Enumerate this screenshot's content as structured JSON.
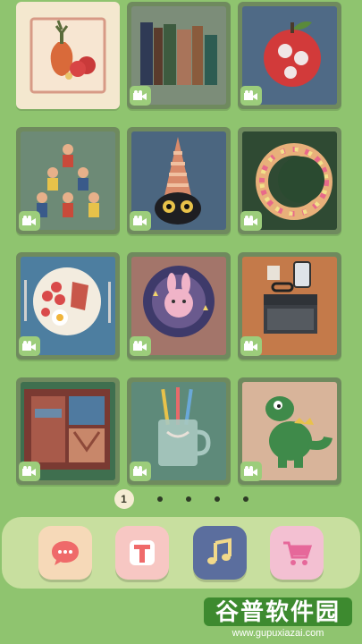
{
  "cards": [
    {
      "name": "still-life-vase",
      "selected": true
    },
    {
      "name": "books"
    },
    {
      "name": "apple"
    },
    {
      "name": "acrobats"
    },
    {
      "name": "wizard-hat-cat"
    },
    {
      "name": "flower-wreath"
    },
    {
      "name": "breakfast-plate"
    },
    {
      "name": "bunny-plate"
    },
    {
      "name": "desk-laptop"
    },
    {
      "name": "open-suitcase"
    },
    {
      "name": "toothbrush-cup"
    },
    {
      "name": "dinosaur-toy"
    }
  ],
  "card_badge_icon": "video-camera-icon",
  "pagination": {
    "current": "1",
    "total_pages": 5
  },
  "dock": {
    "items": [
      {
        "name": "chat",
        "icon": "chat-bubble-icon",
        "bg": "#f6d9b8",
        "fg": "#ef6a6a"
      },
      {
        "name": "text",
        "icon": "text-t-icon",
        "bg": "#f7c7c3",
        "fg": "#ef6a6a"
      },
      {
        "name": "music",
        "icon": "music-note-icon",
        "bg": "#5b6e9e",
        "fg": "#f2d98a"
      },
      {
        "name": "shop",
        "icon": "shopping-cart-icon",
        "bg": "#f3c0d2",
        "fg": "#e6689a"
      }
    ]
  },
  "watermark": {
    "title": "谷普软件园",
    "url": "www.gupuxiazai.com"
  }
}
